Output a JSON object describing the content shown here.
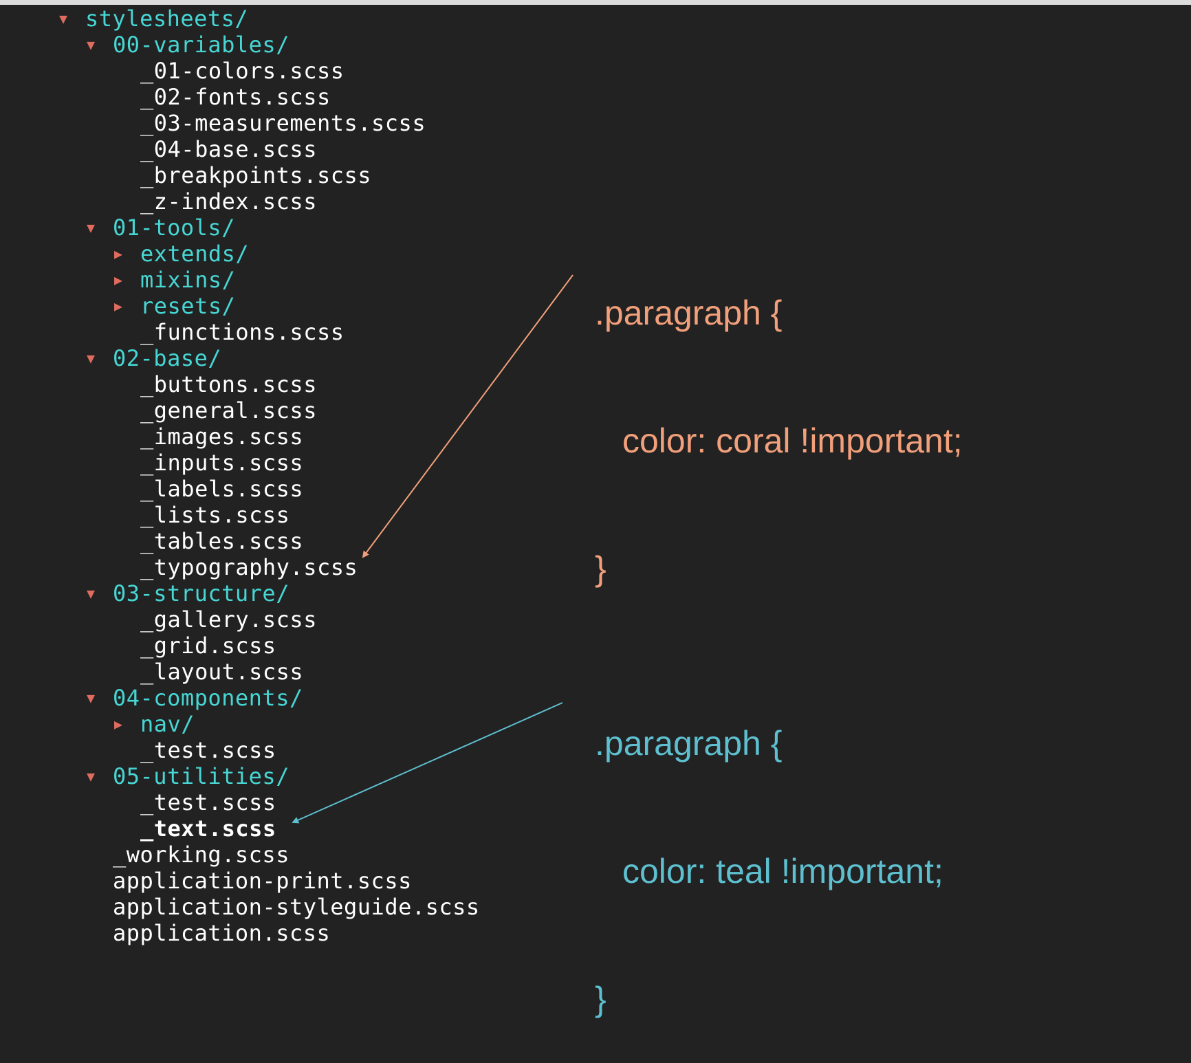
{
  "tree": [
    {
      "type": "folder",
      "expanded": true,
      "depth": 0,
      "name": "stylesheets/"
    },
    {
      "type": "folder",
      "expanded": true,
      "depth": 1,
      "name": "00-variables/"
    },
    {
      "type": "file",
      "depth": 2,
      "name": "_01-colors.scss"
    },
    {
      "type": "file",
      "depth": 2,
      "name": "_02-fonts.scss"
    },
    {
      "type": "file",
      "depth": 2,
      "name": "_03-measurements.scss"
    },
    {
      "type": "file",
      "depth": 2,
      "name": "_04-base.scss"
    },
    {
      "type": "file",
      "depth": 2,
      "name": "_breakpoints.scss"
    },
    {
      "type": "file",
      "depth": 2,
      "name": "_z-index.scss"
    },
    {
      "type": "folder",
      "expanded": true,
      "depth": 1,
      "name": "01-tools/"
    },
    {
      "type": "folder",
      "expanded": false,
      "depth": 2,
      "name": "extends/"
    },
    {
      "type": "folder",
      "expanded": false,
      "depth": 2,
      "name": "mixins/"
    },
    {
      "type": "folder",
      "expanded": false,
      "depth": 2,
      "name": "resets/"
    },
    {
      "type": "file",
      "depth": 2,
      "name": "_functions.scss"
    },
    {
      "type": "folder",
      "expanded": true,
      "depth": 1,
      "name": "02-base/"
    },
    {
      "type": "file",
      "depth": 2,
      "name": "_buttons.scss"
    },
    {
      "type": "file",
      "depth": 2,
      "name": "_general.scss"
    },
    {
      "type": "file",
      "depth": 2,
      "name": "_images.scss"
    },
    {
      "type": "file",
      "depth": 2,
      "name": "_inputs.scss"
    },
    {
      "type": "file",
      "depth": 2,
      "name": "_labels.scss"
    },
    {
      "type": "file",
      "depth": 2,
      "name": "_lists.scss"
    },
    {
      "type": "file",
      "depth": 2,
      "name": "_tables.scss"
    },
    {
      "type": "file",
      "depth": 2,
      "name": "_typography.scss"
    },
    {
      "type": "folder",
      "expanded": true,
      "depth": 1,
      "name": "03-structure/"
    },
    {
      "type": "file",
      "depth": 2,
      "name": "_gallery.scss"
    },
    {
      "type": "file",
      "depth": 2,
      "name": "_grid.scss"
    },
    {
      "type": "file",
      "depth": 2,
      "name": "_layout.scss"
    },
    {
      "type": "folder",
      "expanded": true,
      "depth": 1,
      "name": "04-components/"
    },
    {
      "type": "folder",
      "expanded": false,
      "depth": 2,
      "name": "nav/"
    },
    {
      "type": "file",
      "depth": 2,
      "name": "_test.scss"
    },
    {
      "type": "folder",
      "expanded": true,
      "depth": 1,
      "name": "05-utilities/"
    },
    {
      "type": "file",
      "depth": 2,
      "name": "_test.scss"
    },
    {
      "type": "file",
      "depth": 2,
      "name": "_text.scss",
      "bold": true
    },
    {
      "type": "file",
      "depth": 1,
      "name": "_working.scss"
    },
    {
      "type": "file",
      "depth": 1,
      "name": "application-print.scss"
    },
    {
      "type": "file",
      "depth": 1,
      "name": "application-styleguide.scss"
    },
    {
      "type": "file",
      "depth": 1,
      "name": "application.scss"
    }
  ],
  "icons": {
    "expanded": "▼",
    "collapsed": "▶"
  },
  "annotations": {
    "coral": {
      "color": "#f2a07b",
      "selector": ".paragraph {",
      "declaration": "color: coral !important;",
      "close": "}"
    },
    "teal": {
      "color": "#5dbfcf",
      "selector": ".paragraph {",
      "declaration": "color: teal !important;",
      "close": "}"
    }
  }
}
